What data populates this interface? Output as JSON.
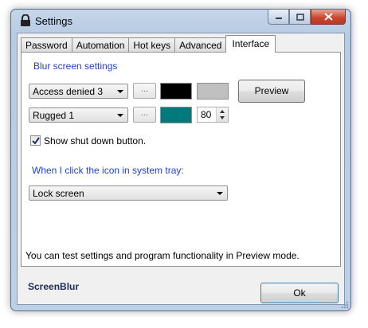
{
  "window": {
    "title": "Settings"
  },
  "tabs": [
    {
      "label": "Password",
      "active": false
    },
    {
      "label": "Automation",
      "active": false
    },
    {
      "label": "Hot keys",
      "active": false
    },
    {
      "label": "Advanced",
      "active": false
    },
    {
      "label": "Interface",
      "active": true
    }
  ],
  "blur": {
    "section_title": "Blur screen settings",
    "row1": {
      "combo_value": "Access denied 3",
      "ellipsis": "...",
      "color1": "#000000",
      "color2": "#c0c0c0"
    },
    "row2": {
      "combo_value": "Rugged 1",
      "ellipsis": "...",
      "color": "#007a7a",
      "opacity": "80"
    },
    "preview_button": "Preview"
  },
  "shutdown": {
    "checked": true,
    "label": "Show shut down button."
  },
  "tray": {
    "section_title": "When I click the icon in system tray:",
    "combo_value": "Lock screen"
  },
  "info_text": "You can test settings and program functionality in Preview mode.",
  "footer": {
    "brand": "ScreenBlur",
    "ok_button": "Ok"
  }
}
